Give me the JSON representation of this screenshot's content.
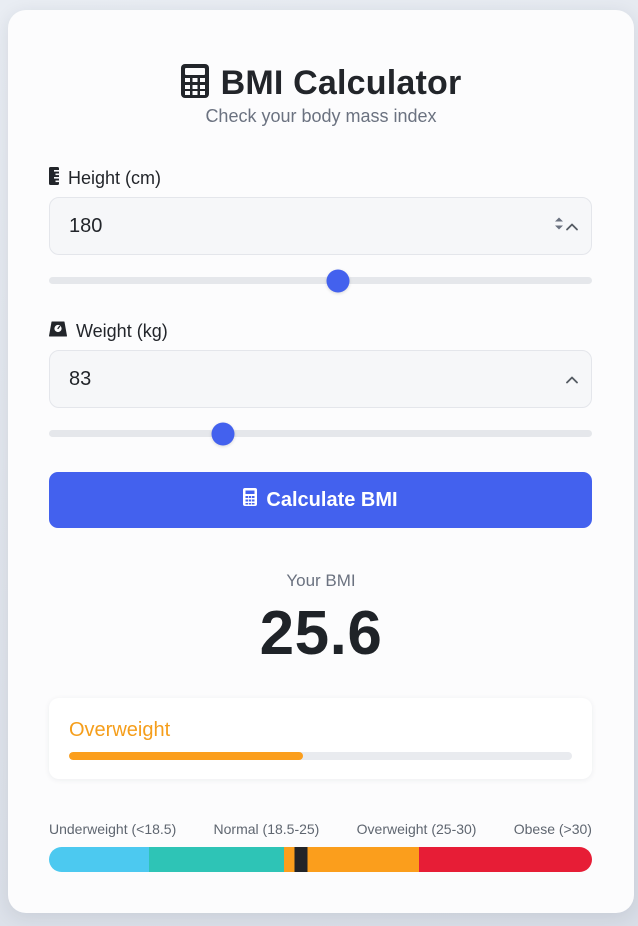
{
  "header": {
    "icon": "calculator-icon",
    "title": "BMI Calculator",
    "subtitle": "Check your body mass index"
  },
  "height": {
    "icon": "ruler-icon",
    "label": "Height (cm)",
    "value": "180",
    "slider_fraction": 0.532
  },
  "weight": {
    "icon": "weight-scale-icon",
    "label": "Weight (kg)",
    "value": "83",
    "slider_fraction": 0.32
  },
  "button": {
    "icon": "calculator-icon",
    "label": "Calculate BMI"
  },
  "result": {
    "label": "Your BMI",
    "value": "25.6",
    "category": "Overweight",
    "progress_fraction": 0.465,
    "category_color": "#f59e1b"
  },
  "scale": {
    "labels": [
      "Underweight (<18.5)",
      "Normal (18.5-25)",
      "Overweight (25-30)",
      "Obese (>30)"
    ],
    "segments": [
      {
        "color": "#4cc9f0",
        "fraction": 0.184
      },
      {
        "color": "#2ec4b6",
        "fraction": 0.249
      },
      {
        "color": "#fb9e1c",
        "fraction": 0.248
      },
      {
        "color": "#e71d36",
        "fraction": 0.319
      }
    ],
    "marker_fraction": 0.465
  },
  "colors": {
    "accent": "#4361ee",
    "thumb": "#4361ee"
  }
}
